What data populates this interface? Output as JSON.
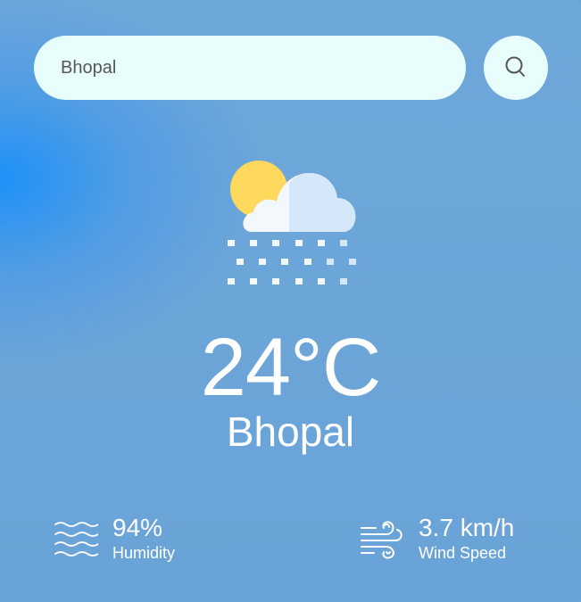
{
  "search": {
    "value": "Bhopal",
    "icon": "search-icon"
  },
  "weather": {
    "icon": "snow-cloud-sun-icon",
    "temperature": "24°C",
    "city": "Bhopal"
  },
  "humidity": {
    "icon": "humidity-icon",
    "value": "94%",
    "label": "Humidity"
  },
  "wind": {
    "icon": "wind-icon",
    "value": "3.7 km/h",
    "label": "Wind Speed"
  },
  "colors": {
    "background_accent": "#1a90fa",
    "background": "#6aa4d8",
    "input_background": "#e7fefd",
    "sun": "#ffd95e",
    "cloud": "#f3f8fd",
    "text": "#ffffff"
  }
}
